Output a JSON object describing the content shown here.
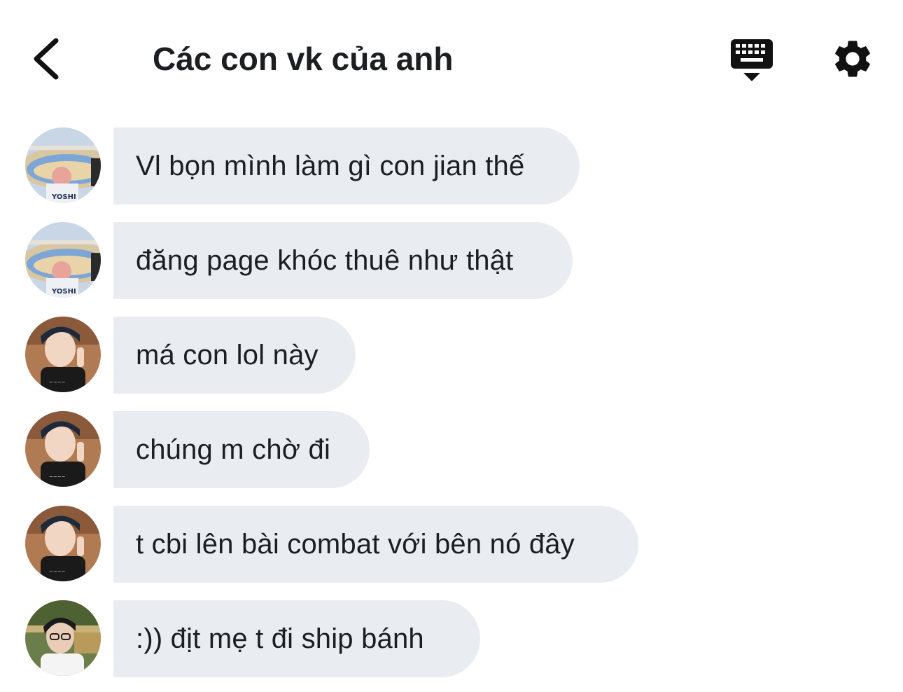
{
  "header": {
    "title": "Các con vk của anh",
    "back_icon": "chevron-left-icon",
    "keyboard_icon": "keyboard-icon",
    "settings_icon": "gear-icon"
  },
  "messages": [
    {
      "text": "Vl bọn mình làm gì con jian thế",
      "avatar": "stadium-avatar"
    },
    {
      "text": "đăng page khóc thuê như thật",
      "avatar": "stadium-avatar"
    },
    {
      "text": "má con lol này",
      "avatar": "peace-sign-avatar"
    },
    {
      "text": "chúng m chờ đi",
      "avatar": "peace-sign-avatar"
    },
    {
      "text": "t cbi lên bài combat với bên nó đây",
      "avatar": "peace-sign-avatar"
    },
    {
      "text": ":)) địt mẹ t đi ship bánh",
      "avatar": "glasses-avatar"
    }
  ],
  "colors": {
    "bubble": "#e9edf1",
    "text": "#1c1e21",
    "icon": "#111111"
  }
}
